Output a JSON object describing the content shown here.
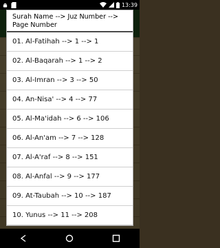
{
  "status_bar": {
    "time": "13:39",
    "left_icons": [
      "android-icon",
      "sd-card-icon"
    ],
    "right_icons": [
      "wifi-icon",
      "signal-icon",
      "battery-icon"
    ]
  },
  "dialog": {
    "title": "Surah Name --> Juz Number --> Page Number",
    "items": [
      "01. Al-Fatihah --> 1 --> 1",
      "02. Al-Baqarah --> 1 --> 2",
      "03. Al-Imran --> 3 --> 50",
      "04. An-Nisa' --> 4 --> 77",
      "05. Al-Ma'idah --> 6 --> 106",
      "06. Al-An'am --> 7 --> 128",
      "07. Al-A'raf --> 8 --> 151",
      "08. Al-Anfal --> 9 --> 177",
      "09. At-Taubah --> 10 --> 187",
      "10. Yunus --> 11 --> 208"
    ]
  },
  "nav_bar": {
    "buttons": [
      "back-icon",
      "home-icon",
      "recent-apps-icon"
    ]
  },
  "colors": {
    "status_bar": "#000000",
    "dialog_bg": "#ffffff",
    "divider": "#cfcfcf",
    "background_page": "#9c8a5e"
  }
}
